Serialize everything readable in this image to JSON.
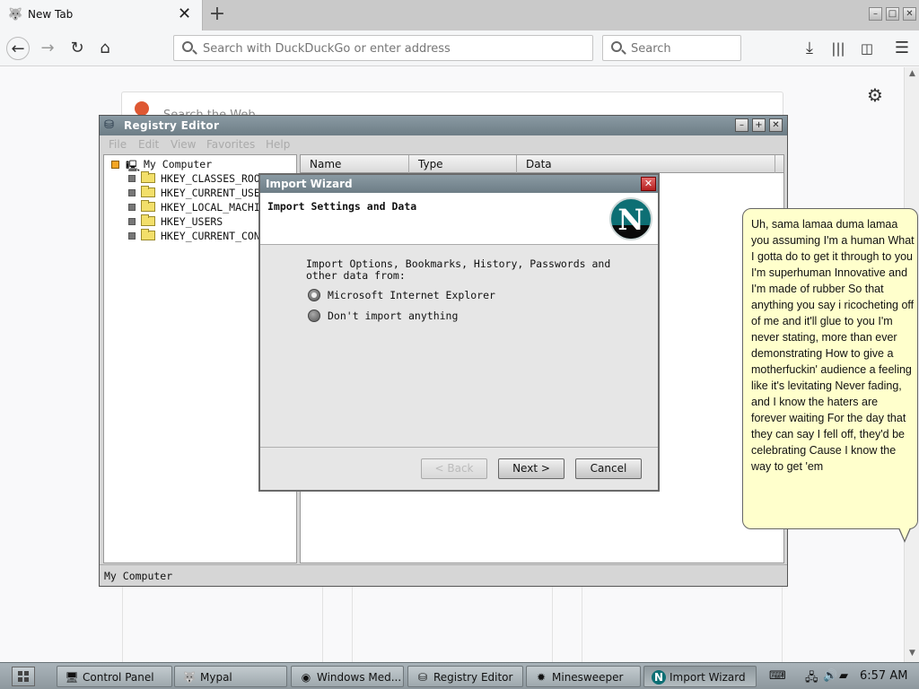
{
  "browser": {
    "tab_title": "New Tab",
    "tab_close": "✕",
    "new_tab": "+",
    "url_placeholder": "Search with DuckDuckGo or enter address",
    "search_placeholder": "Search",
    "web_search_placeholder": "Search the Web"
  },
  "regedit": {
    "title": "Registry Editor",
    "menu": [
      "File",
      "Edit",
      "View",
      "Favorites",
      "Help"
    ],
    "tree_root": "My Computer",
    "tree_items": [
      "HKEY_CLASSES_ROOT",
      "HKEY_CURRENT_USER",
      "HKEY_LOCAL_MACHINE",
      "HKEY_USERS",
      "HKEY_CURRENT_CONFIG"
    ],
    "columns": [
      "Name",
      "Type",
      "Data"
    ],
    "status": "My Computer"
  },
  "wizard": {
    "title": "Import Wizard",
    "heading": "Import Settings and Data",
    "logo_letter": "N",
    "prompt": "Import Options, Bookmarks, History, Passwords and other data from:",
    "options": [
      {
        "label": "Microsoft Internet Explorer",
        "selected": true
      },
      {
        "label": "Don't import anything",
        "selected": false
      }
    ],
    "buttons": {
      "back": "< Back",
      "next": "Next >",
      "cancel": "Cancel"
    }
  },
  "bubble": {
    "text": "Uh, sama lamaa duma lamaa you assuming I'm a human What I gotta do to get it through to you I'm superhuman Innovative and I'm made of rubber So that anything you say i ricocheting off of me and it'll glue to you I'm never stating, more than ever demonstrating How to give a motherfuckin' audience a feeling like it's levitating Never fading, and I know the haters are forever waiting For the day that they can say I fell off, they'd be celebrating Cause I know the way to get 'em"
  },
  "taskbar": {
    "items": [
      {
        "label": "Control Panel",
        "icon": "control-panel-icon",
        "active": false
      },
      {
        "label": "Mypal",
        "icon": "mypal-icon",
        "active": false
      },
      {
        "label": "Windows Med...",
        "icon": "media-player-icon",
        "active": false
      },
      {
        "label": "Registry Editor",
        "icon": "regedit-icon",
        "active": false
      },
      {
        "label": "Minesweeper",
        "icon": "minesweeper-icon",
        "active": false
      },
      {
        "label": "Import Wizard",
        "icon": "netscape-icon",
        "active": true
      }
    ],
    "clock": "6:57 AM"
  }
}
